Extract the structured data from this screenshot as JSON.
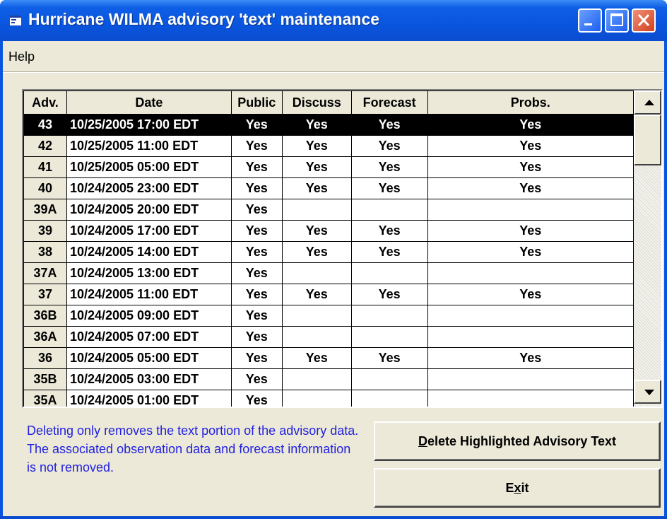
{
  "window": {
    "title": "Hurricane WILMA advisory 'text' maintenance",
    "controls": [
      "minimize-icon",
      "maximize-icon",
      "close-icon"
    ]
  },
  "menu": {
    "help": "Help"
  },
  "table": {
    "columns": [
      "Adv.",
      "Date",
      "Public",
      "Discuss",
      "Forecast",
      "Probs."
    ],
    "selected_index": 0,
    "rows": [
      {
        "adv": "43",
        "date": "10/25/2005 17:00 EDT",
        "public": "Yes",
        "discuss": "Yes",
        "forecast": "Yes",
        "probs": "Yes"
      },
      {
        "adv": "42",
        "date": "10/25/2005 11:00 EDT",
        "public": "Yes",
        "discuss": "Yes",
        "forecast": "Yes",
        "probs": "Yes"
      },
      {
        "adv": "41",
        "date": "10/25/2005 05:00 EDT",
        "public": "Yes",
        "discuss": "Yes",
        "forecast": "Yes",
        "probs": "Yes"
      },
      {
        "adv": "40",
        "date": "10/24/2005 23:00 EDT",
        "public": "Yes",
        "discuss": "Yes",
        "forecast": "Yes",
        "probs": "Yes"
      },
      {
        "adv": "39A",
        "date": "10/24/2005 20:00 EDT",
        "public": "Yes",
        "discuss": "",
        "forecast": "",
        "probs": ""
      },
      {
        "adv": "39",
        "date": "10/24/2005 17:00 EDT",
        "public": "Yes",
        "discuss": "Yes",
        "forecast": "Yes",
        "probs": "Yes"
      },
      {
        "adv": "38",
        "date": "10/24/2005 14:00 EDT",
        "public": "Yes",
        "discuss": "Yes",
        "forecast": "Yes",
        "probs": "Yes"
      },
      {
        "adv": "37A",
        "date": "10/24/2005 13:00 EDT",
        "public": "Yes",
        "discuss": "",
        "forecast": "",
        "probs": ""
      },
      {
        "adv": "37",
        "date": "10/24/2005 11:00 EDT",
        "public": "Yes",
        "discuss": "Yes",
        "forecast": "Yes",
        "probs": "Yes"
      },
      {
        "adv": "36B",
        "date": "10/24/2005 09:00 EDT",
        "public": "Yes",
        "discuss": "",
        "forecast": "",
        "probs": ""
      },
      {
        "adv": "36A",
        "date": "10/24/2005 07:00 EDT",
        "public": "Yes",
        "discuss": "",
        "forecast": "",
        "probs": ""
      },
      {
        "adv": "36",
        "date": "10/24/2005 05:00 EDT",
        "public": "Yes",
        "discuss": "Yes",
        "forecast": "Yes",
        "probs": "Yes"
      },
      {
        "adv": "35B",
        "date": "10/24/2005 03:00 EDT",
        "public": "Yes",
        "discuss": "",
        "forecast": "",
        "probs": ""
      },
      {
        "adv": "35A",
        "date": "10/24/2005 01:00 EDT",
        "public": "Yes",
        "discuss": "",
        "forecast": "",
        "probs": ""
      }
    ]
  },
  "note": "Deleting only removes the text portion of the advisory data.  The associated observation data and forecast information is not removed.",
  "buttons": {
    "delete_mnemonic": "D",
    "delete_rest": "elete Highlighted Advisory Text",
    "exit_pre": "E",
    "exit_mnemonic": "x",
    "exit_post": "it"
  },
  "colors": {
    "titlebar": "#0a55de",
    "note_text": "#1f1fe0",
    "selection": "#000000",
    "face": "#ece9d8"
  }
}
